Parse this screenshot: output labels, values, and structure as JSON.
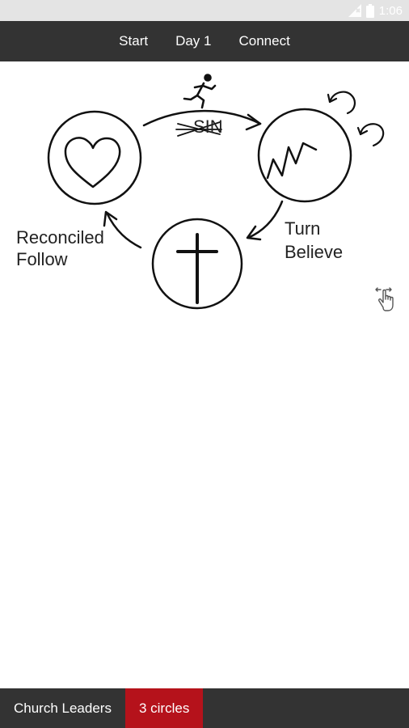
{
  "status_bar": {
    "time": "1:06",
    "icons": [
      "signal-icon",
      "battery-icon"
    ]
  },
  "top_nav": {
    "items": [
      {
        "label": "Start"
      },
      {
        "label": "Day 1"
      },
      {
        "label": "Connect"
      }
    ]
  },
  "diagram": {
    "label_left_1": "Reconciled",
    "label_left_2": "Follow",
    "label_right_1": "Turn",
    "label_right_2": "Believe",
    "arrow_text": "SIN",
    "icons": [
      "heart-icon",
      "broken-zigzag-icon",
      "cross-icon",
      "running-person-icon",
      "return-arrows-icon",
      "swipe-hand-icon"
    ]
  },
  "bottom_tabs": {
    "items": [
      {
        "label": "Church Leaders",
        "active": false
      },
      {
        "label": "3 circles",
        "active": true
      }
    ],
    "active_color": "#b5121b"
  },
  "colors": {
    "bar_background": "#333333",
    "status_background": "#e4e4e4",
    "accent": "#b5121b"
  }
}
